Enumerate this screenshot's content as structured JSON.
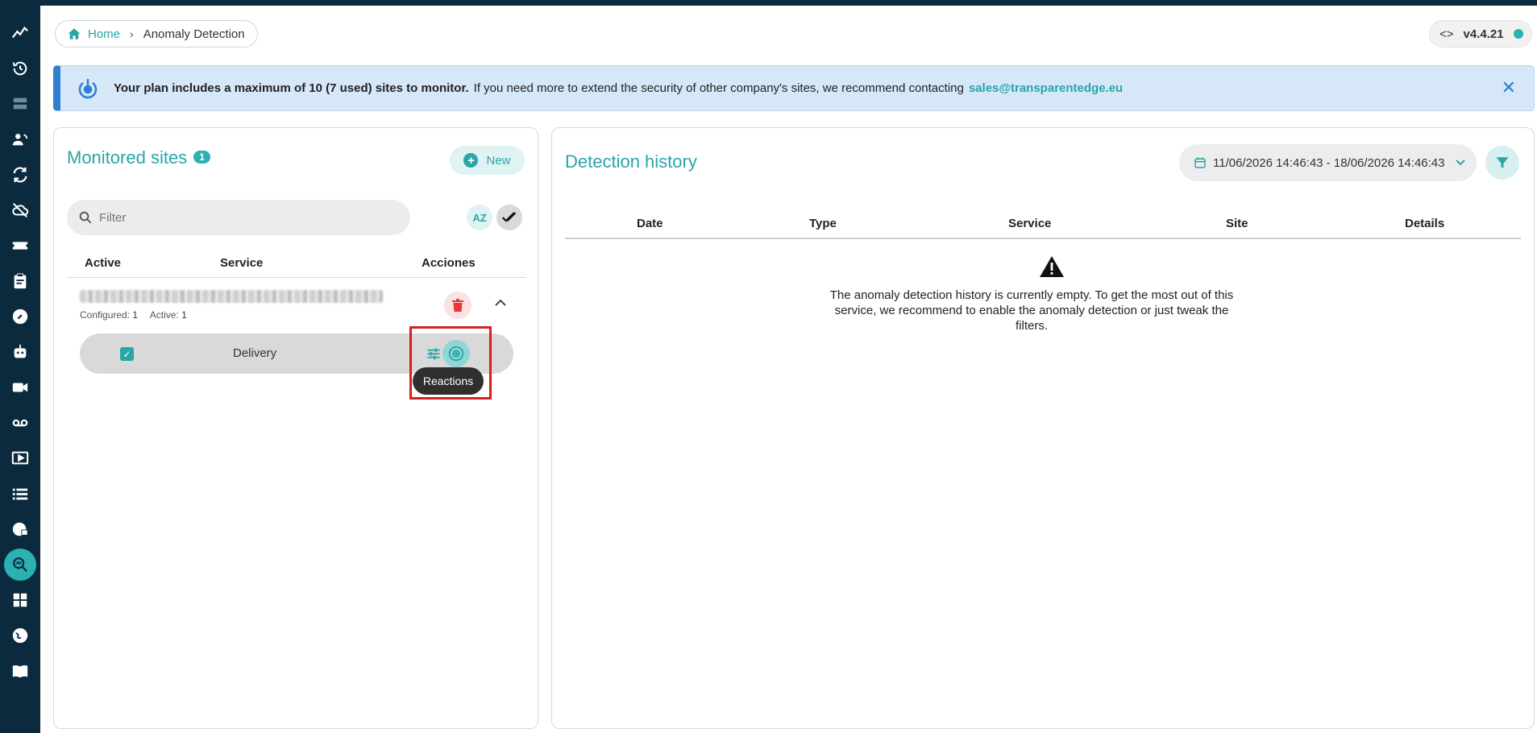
{
  "sidebar": {
    "items": [
      {
        "name": "analytics-icon"
      },
      {
        "name": "history-icon"
      },
      {
        "name": "servers-icon"
      },
      {
        "name": "users-sync-icon"
      },
      {
        "name": "refresh-icon"
      },
      {
        "name": "cloud-off-icon"
      },
      {
        "name": "ticket-icon"
      },
      {
        "name": "clipboard-icon"
      },
      {
        "name": "wrench-icon"
      },
      {
        "name": "robot-icon"
      },
      {
        "name": "video-camera-icon"
      },
      {
        "name": "voicemail-icon"
      },
      {
        "name": "play-screen-icon"
      },
      {
        "name": "list-icon"
      },
      {
        "name": "globe-lock-icon"
      },
      {
        "name": "anomaly-search-icon",
        "active": true
      },
      {
        "name": "dashboard-icon"
      },
      {
        "name": "world-icon"
      },
      {
        "name": "book-icon"
      }
    ]
  },
  "breadcrumb": {
    "home": "Home",
    "current": "Anomaly Detection"
  },
  "version": {
    "code_icon": "<>",
    "label": "v4.4.21"
  },
  "banner": {
    "bold": "Your plan includes a maximum of 10 (7 used) sites to monitor.",
    "text": "If you need more to extend the security of other company's sites, we recommend contacting",
    "link": "sales@transparentedge.eu",
    "close": "✕"
  },
  "monitored": {
    "title": "Monitored sites",
    "count": "1",
    "new_label": "New",
    "filter_placeholder": "Filter",
    "sort_label": "AZ",
    "columns": {
      "active": "Active",
      "service": "Service",
      "actions": "Acciones"
    },
    "site": {
      "configured_label": "Configured:",
      "configured_value": "1",
      "active_label": "Active:",
      "active_value": "1"
    },
    "service_row": {
      "name": "Delivery",
      "checked": true
    },
    "tooltip": "Reactions"
  },
  "history": {
    "title": "Detection history",
    "date_range": "11/06/2026 14:46:43 - 18/06/2026 14:46:43",
    "columns": {
      "date": "Date",
      "type": "Type",
      "service": "Service",
      "site": "Site",
      "details": "Details"
    },
    "empty_message": "The anomaly detection history is currently empty. To get the most out of this service, we recommend to enable the anomaly detection or just tweak the filters."
  },
  "colors": {
    "accent": "#2aa5a8",
    "sidebar": "#0b2a3d",
    "banner_bg": "#d6e7f8",
    "banner_border": "#2f7fd3",
    "danger": "#e53935"
  }
}
